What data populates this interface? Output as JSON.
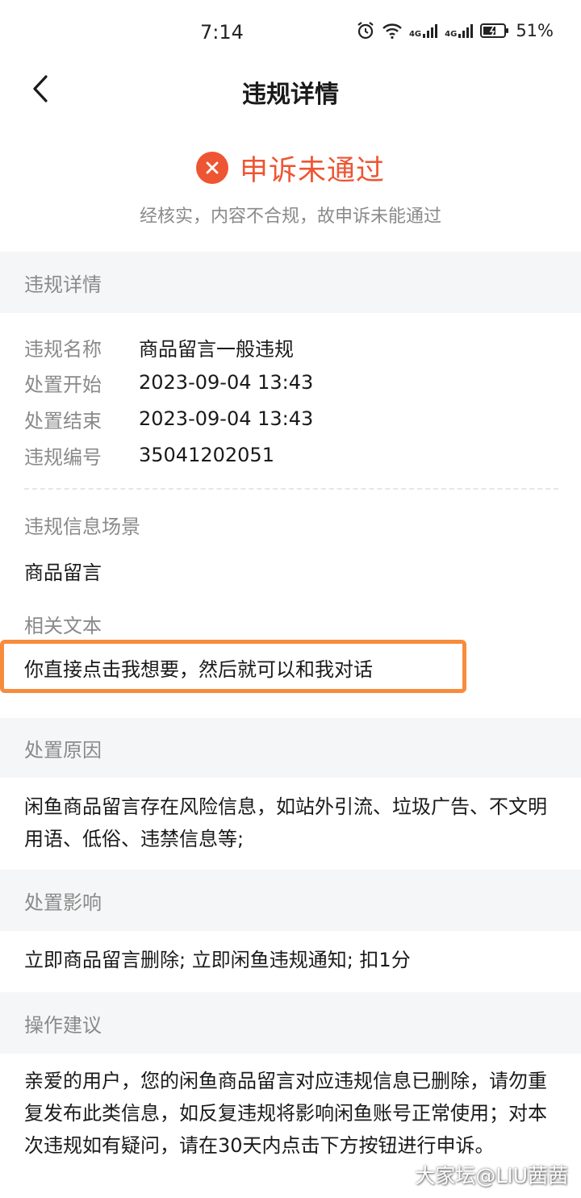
{
  "status_bar": {
    "time": "7:14",
    "battery_percent": "51%",
    "network_1": "4G",
    "network_2": "4G"
  },
  "nav": {
    "title": "违规详情"
  },
  "result": {
    "title": "申诉未通过",
    "description": "经核实，内容不合规，故申诉未能通过",
    "accent_color": "#ee5533"
  },
  "violation_details": {
    "section_title": "违规详情",
    "rows": [
      {
        "label": "违规名称",
        "value": "商品留言一般违规"
      },
      {
        "label": "处置开始",
        "value": "2023-09-04 13:43"
      },
      {
        "label": "处置结束",
        "value": "2023-09-04 13:43"
      },
      {
        "label": "违规编号",
        "value": "35041202051"
      }
    ],
    "scene_label": "违规信息场景",
    "scene_value": "商品留言",
    "text_label": "相关文本",
    "text_value": "你直接点击我想要，然后就可以和我对话"
  },
  "reason": {
    "section_title": "处置原因",
    "text": "闲鱼商品留言存在风险信息，如站外引流、垃圾广告、不文明用语、低俗、违禁信息等;"
  },
  "impact": {
    "section_title": "处置影响",
    "text": "立即商品留言删除; 立即闲鱼违规通知; 扣1分"
  },
  "suggestion": {
    "section_title": "操作建议",
    "text": "亲爱的用户，您的闲鱼商品留言对应违规信息已删除，请勿重复发布此类信息，如反复违规将影响闲鱼账号正常使用；对本次违规如有疑问，请在30天内点击下方按钮进行申诉。"
  },
  "watermark": {
    "text": "大家坛@LIU茜茜"
  },
  "colors": {
    "highlight_border": "#f78c3c",
    "section_bg": "#f5f6f7",
    "muted_text": "#8a8a8a"
  }
}
